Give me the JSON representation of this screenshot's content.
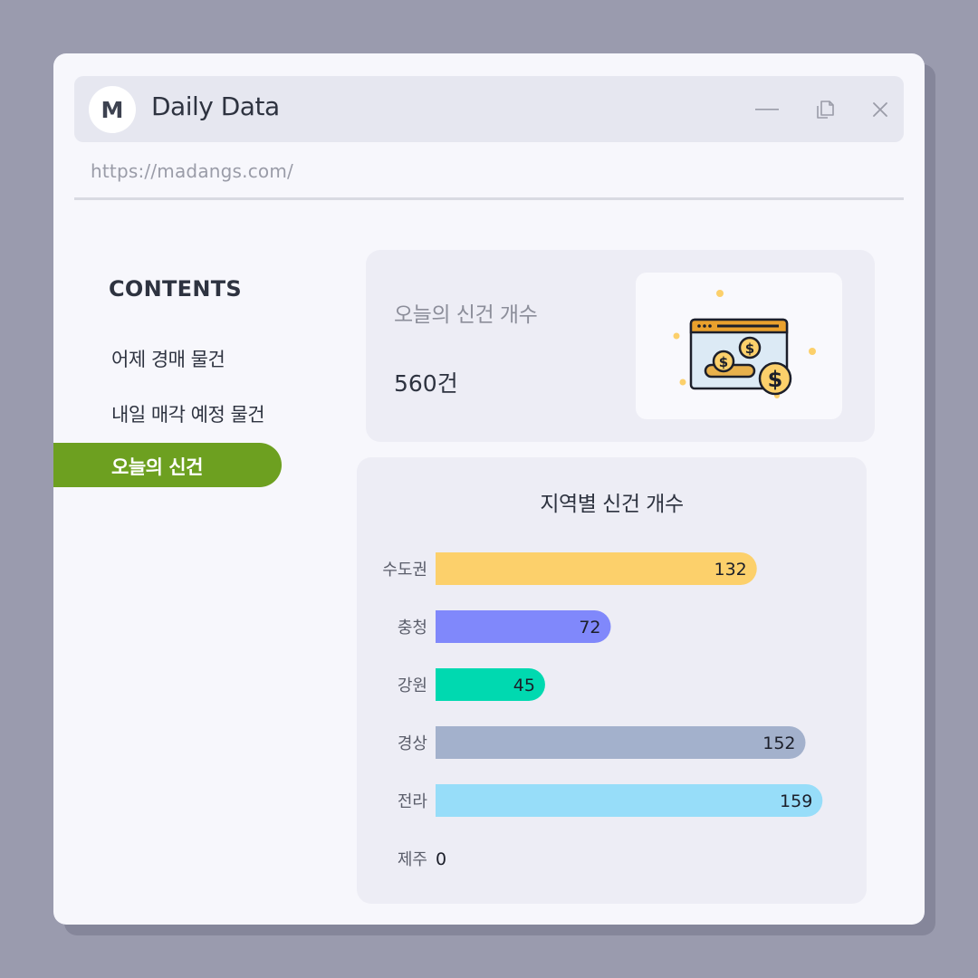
{
  "app": {
    "avatar_letter": "M",
    "title": "Daily Data",
    "url": "https://madangs.com/"
  },
  "window_controls": {
    "minimize_icon": "minimize-icon",
    "restore_icon": "restore-icon",
    "close_icon": "close-icon"
  },
  "sidebar": {
    "heading": "CONTENTS",
    "items": [
      {
        "label": "어제 경매 물건",
        "active": false
      },
      {
        "label": "내일 매각 예정 물건",
        "active": false
      },
      {
        "label": "오늘의 신건",
        "active": true
      }
    ],
    "active_color": "#6da020"
  },
  "stat": {
    "label": "오늘의 신건 개수",
    "value": "560건",
    "icon": "auction-money-icon"
  },
  "chart_data": {
    "type": "bar",
    "orientation": "horizontal",
    "title": "지역별 신건 개수",
    "categories": [
      "수도권",
      "충청",
      "강원",
      "경상",
      "전라",
      "제주"
    ],
    "values": [
      132,
      72,
      45,
      152,
      159,
      0
    ],
    "colors": [
      "#fcd06b",
      "#8088fb",
      "#00d9b0",
      "#a3b1cc",
      "#97ddf9",
      "#cccccc"
    ],
    "xlim": [
      0,
      160
    ],
    "grid": false
  }
}
